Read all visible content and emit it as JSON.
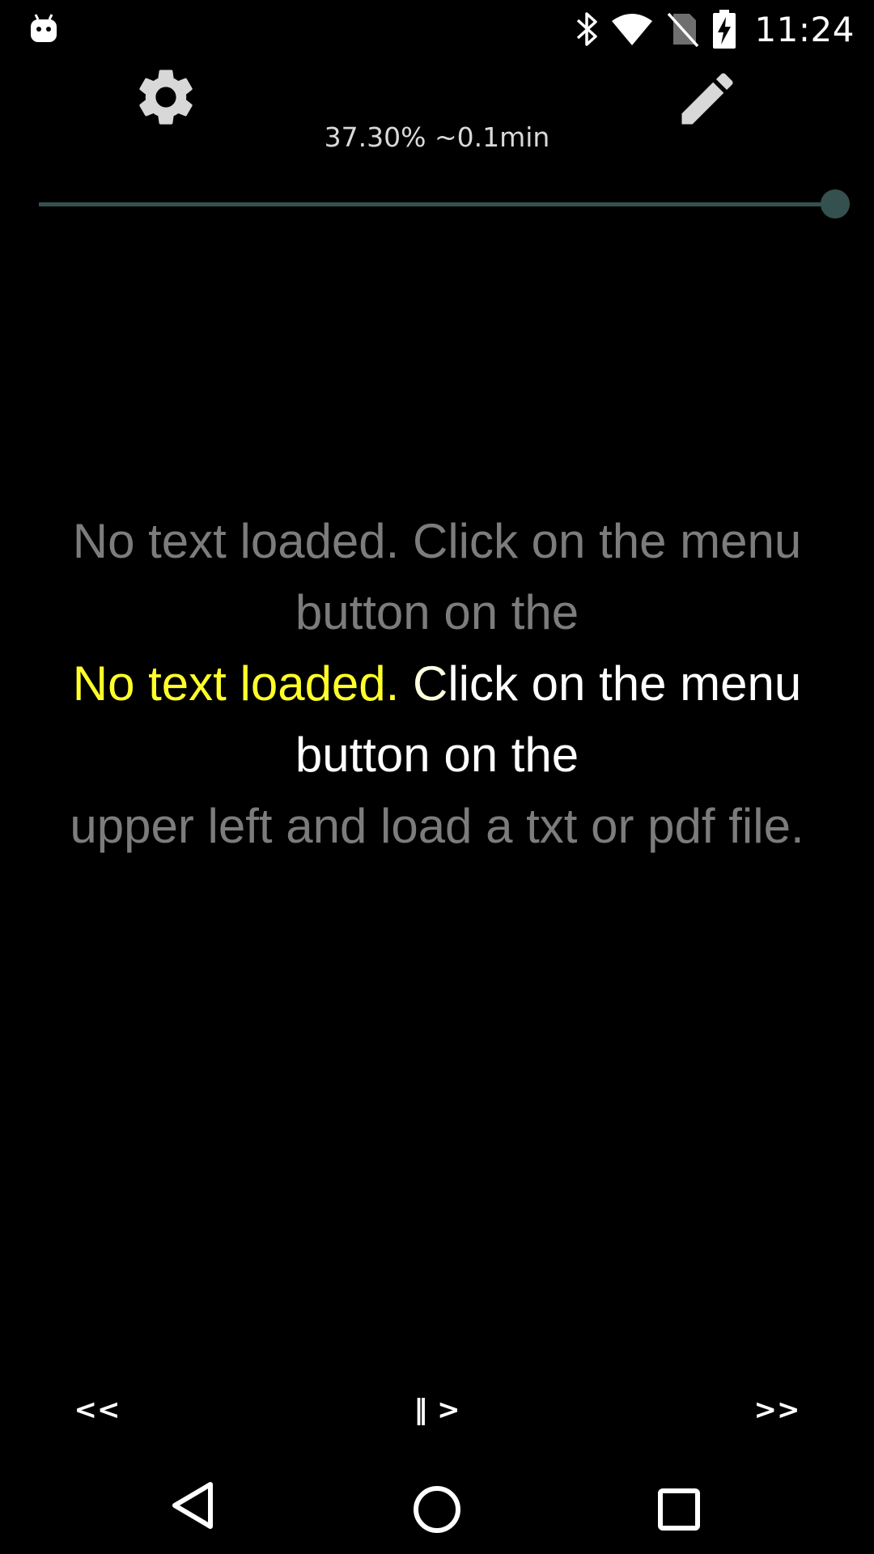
{
  "status_bar": {
    "time": "11:24",
    "icons": [
      "android-debug-icon",
      "bluetooth-icon",
      "wifi-icon",
      "no-sim-icon",
      "battery-charging-icon"
    ]
  },
  "toolbar": {
    "settings_icon": "gear-icon",
    "edit_icon": "pencil-icon",
    "progress_text": "37.30% ~0.1min"
  },
  "seekbar": {
    "value": 1.0,
    "color": "#35514f"
  },
  "reader": {
    "prev_line_1": "No text loaded. Click on the menu",
    "prev_line_2": "button on the",
    "current_highlight": "No text loaded.",
    "current_highlight_2": " C",
    "current_rest": "lick on the menu",
    "current_line_2": "button on the",
    "next_line": "upper left and load a txt or pdf file.",
    "highlight_color": "#ffff2a",
    "dim_color": "#7c7c7c"
  },
  "controls": {
    "rewind": "<<",
    "play_pause": "‖ >",
    "fast_forward": ">>"
  },
  "nav_bar": {
    "back": "back-triangle-icon",
    "home": "home-circle-icon",
    "recents": "recents-square-icon"
  }
}
